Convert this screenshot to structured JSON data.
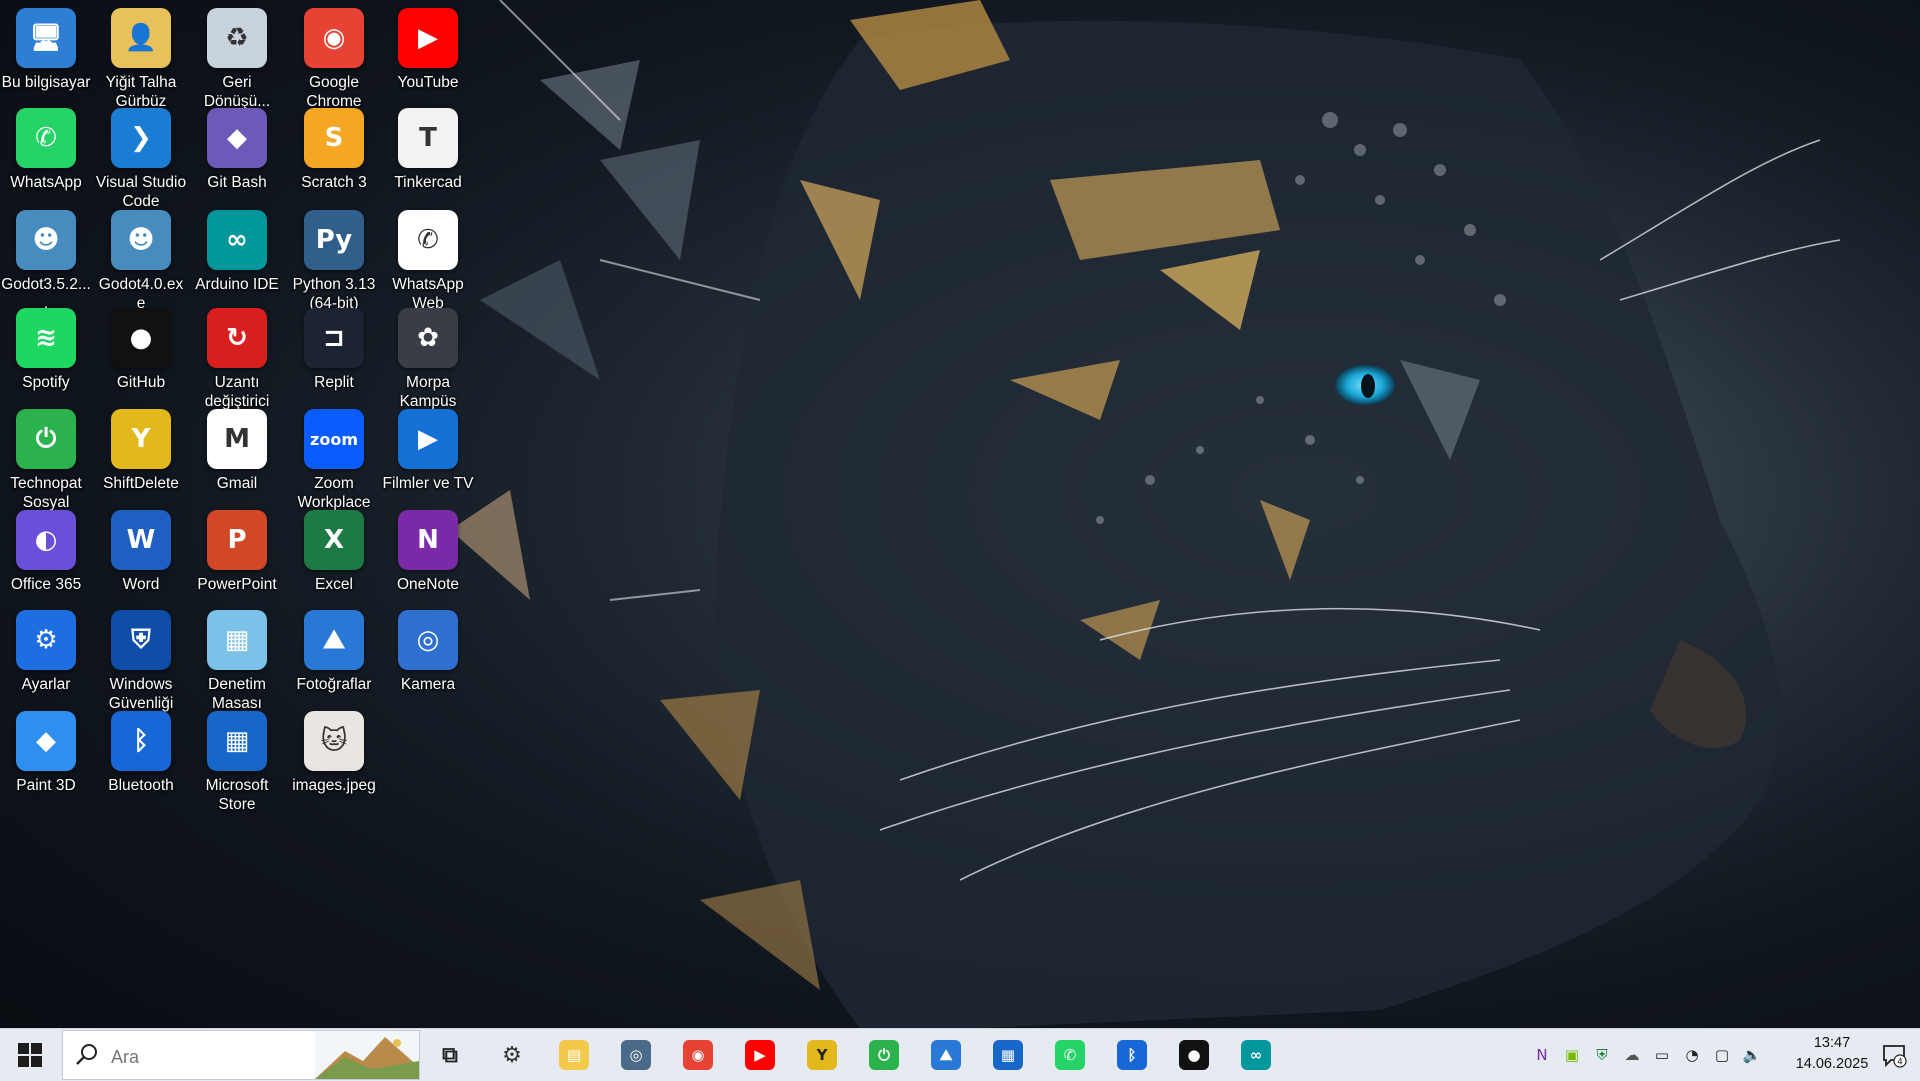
{
  "desktop": {
    "icons": [
      {
        "label": "Bu bilgisayar",
        "icon": "computer-icon",
        "bg": "#2d7fd6",
        "glyph": "🖥",
        "col": 0,
        "row": 0,
        "shortcut": false
      },
      {
        "label": "Yiğit Talha Gürbüz",
        "icon": "user-folder-icon",
        "bg": "#e8c15a",
        "glyph": "👤",
        "col": 1,
        "row": 0,
        "shortcut": false
      },
      {
        "label": "Geri Dönüşü...",
        "icon": "recycle-bin-icon",
        "bg": "#c8d3dc",
        "glyph": "♻",
        "col": 2,
        "row": 0,
        "shortcut": false
      },
      {
        "label": "Google Chrome",
        "icon": "chrome-icon",
        "bg": "#e84235",
        "glyph": "◉",
        "col": 3,
        "row": 0,
        "shortcut": true
      },
      {
        "label": "YouTube",
        "icon": "youtube-icon",
        "bg": "#ff0000",
        "glyph": "▶",
        "col": 4,
        "row": 0,
        "shortcut": true
      },
      {
        "label": "WhatsApp",
        "icon": "whatsapp-icon",
        "bg": "#25d366",
        "glyph": "✆",
        "col": 0,
        "row": 1,
        "shortcut": true
      },
      {
        "label": "Visual Studio Code",
        "icon": "vscode-icon",
        "bg": "#1b7cd3",
        "glyph": "❯",
        "col": 1,
        "row": 1,
        "shortcut": true
      },
      {
        "label": "Git Bash",
        "icon": "git-bash-icon",
        "bg": "#6d5ab8",
        "glyph": "◆",
        "col": 2,
        "row": 1,
        "shortcut": true
      },
      {
        "label": "Scratch 3",
        "icon": "scratch-icon",
        "bg": "#f5a623",
        "glyph": "S",
        "col": 3,
        "row": 1,
        "shortcut": true
      },
      {
        "label": "Tinkercad",
        "icon": "tinkercad-icon",
        "bg": "#f2f2f2",
        "glyph": "T",
        "col": 4,
        "row": 1,
        "shortcut": true
      },
      {
        "label": "Godot3.5.2....",
        "icon": "godot-icon",
        "bg": "#478cbf",
        "glyph": "☻",
        "col": 0,
        "row": 2,
        "shortcut": false
      },
      {
        "label": "Godot4.0.exe",
        "icon": "godot-icon",
        "bg": "#478cbf",
        "glyph": "☻",
        "col": 1,
        "row": 2,
        "shortcut": false
      },
      {
        "label": "Arduino IDE",
        "icon": "arduino-icon",
        "bg": "#00979c",
        "glyph": "∞",
        "col": 2,
        "row": 2,
        "shortcut": true
      },
      {
        "label": "Python 3.13 (64-bit)",
        "icon": "python-icon",
        "bg": "#2f5f8a",
        "glyph": "Py",
        "col": 3,
        "row": 2,
        "shortcut": true
      },
      {
        "label": "WhatsApp Web",
        "icon": "whatsapp-web-icon",
        "bg": "#ffffff",
        "glyph": "✆",
        "col": 4,
        "row": 2,
        "shortcut": true
      },
      {
        "label": "Spotify",
        "icon": "spotify-icon",
        "bg": "#1ed760",
        "glyph": "≋",
        "col": 0,
        "row": 3,
        "shortcut": true
      },
      {
        "label": "GitHub",
        "icon": "github-icon",
        "bg": "#111111",
        "glyph": "●",
        "col": 1,
        "row": 3,
        "shortcut": true
      },
      {
        "label": "Uzantı değiştirici",
        "icon": "extension-changer-icon",
        "bg": "#d91e1e",
        "glyph": "↻",
        "col": 2,
        "row": 3,
        "shortcut": true
      },
      {
        "label": "Replit",
        "icon": "replit-icon",
        "bg": "#1c2333",
        "glyph": "⊐",
        "col": 3,
        "row": 3,
        "shortcut": true
      },
      {
        "label": "Morpa Kampüs",
        "icon": "morpa-icon",
        "bg": "#3a3d46",
        "glyph": "✿",
        "col": 4,
        "row": 3,
        "shortcut": true
      },
      {
        "label": "Technopat Sosyal",
        "icon": "technopat-icon",
        "bg": "#2bb24c",
        "glyph": "⏻",
        "col": 0,
        "row": 4,
        "shortcut": true
      },
      {
        "label": "ShiftDelete",
        "icon": "shiftdelete-icon",
        "bg": "#e3b81d",
        "glyph": "Y",
        "col": 1,
        "row": 4,
        "shortcut": true
      },
      {
        "label": "Gmail",
        "icon": "gmail-icon",
        "bg": "#ffffff",
        "glyph": "M",
        "col": 2,
        "row": 4,
        "shortcut": true
      },
      {
        "label": "Zoom Workplace",
        "icon": "zoom-icon",
        "bg": "#0b5cff",
        "glyph": "zoom",
        "col": 3,
        "row": 4,
        "shortcut": true
      },
      {
        "label": "Filmler ve TV",
        "icon": "movies-tv-icon",
        "bg": "#1570d6",
        "glyph": "▶",
        "col": 4,
        "row": 4,
        "shortcut": true
      },
      {
        "label": "Office 365",
        "icon": "office-icon",
        "bg": "#6b4fd8",
        "glyph": "◐",
        "col": 0,
        "row": 5,
        "shortcut": true
      },
      {
        "label": "Word",
        "icon": "word-icon",
        "bg": "#1e5fc1",
        "glyph": "W",
        "col": 1,
        "row": 5,
        "shortcut": true
      },
      {
        "label": "PowerPoint",
        "icon": "powerpoint-icon",
        "bg": "#d24726",
        "glyph": "P",
        "col": 2,
        "row": 5,
        "shortcut": true
      },
      {
        "label": "Excel",
        "icon": "excel-icon",
        "bg": "#1d7a44",
        "glyph": "X",
        "col": 3,
        "row": 5,
        "shortcut": true
      },
      {
        "label": "OneNote",
        "icon": "onenote-icon",
        "bg": "#7a2aa6",
        "glyph": "N",
        "col": 4,
        "row": 5,
        "shortcut": true
      },
      {
        "label": "Ayarlar",
        "icon": "settings-gear-icon",
        "bg": "#1d6ee0",
        "glyph": "⚙",
        "col": 0,
        "row": 6,
        "shortcut": true
      },
      {
        "label": "Windows Güvenliği",
        "icon": "windows-security-icon",
        "bg": "#0f4ea8",
        "glyph": "⛨",
        "col": 1,
        "row": 6,
        "shortcut": true
      },
      {
        "label": "Denetim Masası",
        "icon": "control-panel-icon",
        "bg": "#7cc1e8",
        "glyph": "▦",
        "col": 2,
        "row": 6,
        "shortcut": false
      },
      {
        "label": "Fotoğraflar",
        "icon": "photos-icon",
        "bg": "#2a78d6",
        "glyph": "⛰",
        "col": 3,
        "row": 6,
        "shortcut": true
      },
      {
        "label": "Kamera",
        "icon": "camera-icon",
        "bg": "#2f6fd0",
        "glyph": "◎",
        "col": 4,
        "row": 6,
        "shortcut": true
      },
      {
        "label": "Paint 3D",
        "icon": "paint3d-icon",
        "bg": "#2f8ff0",
        "glyph": "◆",
        "col": 0,
        "row": 7,
        "shortcut": true
      },
      {
        "label": "Bluetooth",
        "icon": "bluetooth-icon",
        "bg": "#1767d6",
        "glyph": "ᛒ",
        "col": 1,
        "row": 7,
        "shortcut": true
      },
      {
        "label": "Microsoft Store",
        "icon": "microsoft-store-icon",
        "bg": "#1667c7",
        "glyph": "▦",
        "col": 2,
        "row": 7,
        "shortcut": true
      },
      {
        "label": "images.jpeg",
        "icon": "image-file-thumbnail-icon",
        "bg": "#e9e6e1",
        "glyph": "🐱",
        "col": 3,
        "row": 7,
        "shortcut": false
      }
    ]
  },
  "taskbar": {
    "start_icon": "windows-start-icon",
    "search_placeholder": "Ara",
    "pinned": [
      {
        "name": "task-view",
        "icon": "task-view-icon",
        "bg": "transparent",
        "glyph": "⧉",
        "color": "#222"
      },
      {
        "name": "settings",
        "icon": "settings-gear-icon",
        "bg": "transparent",
        "glyph": "⚙",
        "color": "#333"
      },
      {
        "name": "file-explorer",
        "icon": "folder-icon",
        "bg": "#f2c94c",
        "glyph": "▤",
        "color": "#fff"
      },
      {
        "name": "camera",
        "icon": "camera-icon",
        "bg": "#4b6a8a",
        "glyph": "◎",
        "color": "#fff"
      },
      {
        "name": "chrome",
        "icon": "chrome-icon",
        "bg": "#e84235",
        "glyph": "◉",
        "color": "#fff"
      },
      {
        "name": "youtube",
        "icon": "youtube-icon",
        "bg": "#ff0000",
        "glyph": "▶",
        "color": "#fff"
      },
      {
        "name": "shiftdelete",
        "icon": "shiftdelete-icon",
        "bg": "#e3b81d",
        "glyph": "Y",
        "color": "#222"
      },
      {
        "name": "technopat",
        "icon": "technopat-icon",
        "bg": "#2bb24c",
        "glyph": "⏻",
        "color": "#fff"
      },
      {
        "name": "photos",
        "icon": "photos-icon",
        "bg": "#2a78d6",
        "glyph": "⛰",
        "color": "#fff"
      },
      {
        "name": "microsoft-store",
        "icon": "microsoft-store-icon",
        "bg": "#1667c7",
        "glyph": "▦",
        "color": "#fff"
      },
      {
        "name": "whatsapp",
        "icon": "whatsapp-icon",
        "bg": "#25d366",
        "glyph": "✆",
        "color": "#fff"
      },
      {
        "name": "bluetooth",
        "icon": "bluetooth-icon",
        "bg": "#1767d6",
        "glyph": "ᛒ",
        "color": "#fff"
      },
      {
        "name": "github",
        "icon": "github-icon",
        "bg": "#111111",
        "glyph": "●",
        "color": "#fff"
      },
      {
        "name": "arduino",
        "icon": "arduino-icon",
        "bg": "#00979c",
        "glyph": "∞",
        "color": "#fff"
      }
    ],
    "tray": [
      {
        "name": "onenote",
        "icon": "onenote-icon",
        "glyph": "N",
        "color": "#7a2aa6"
      },
      {
        "name": "nvidia",
        "icon": "nvidia-icon",
        "glyph": "▣",
        "color": "#76b900"
      },
      {
        "name": "security",
        "icon": "windows-security-icon",
        "glyph": "⛨",
        "color": "#1b7f3a"
      },
      {
        "name": "onedrive",
        "icon": "cloud-icon",
        "glyph": "☁",
        "color": "#555"
      },
      {
        "name": "battery",
        "icon": "battery-icon",
        "glyph": "▭",
        "color": "#222"
      },
      {
        "name": "wifi",
        "icon": "wifi-icon",
        "glyph": "◔",
        "color": "#222"
      },
      {
        "name": "device",
        "icon": "device-icon",
        "glyph": "▢",
        "color": "#222"
      },
      {
        "name": "volume",
        "icon": "volume-icon",
        "glyph": "🔈",
        "color": "#222"
      }
    ],
    "clock": {
      "time": "13:47",
      "date": "14.06.2025"
    },
    "notifications": {
      "icon": "notification-icon",
      "count": "4"
    }
  }
}
